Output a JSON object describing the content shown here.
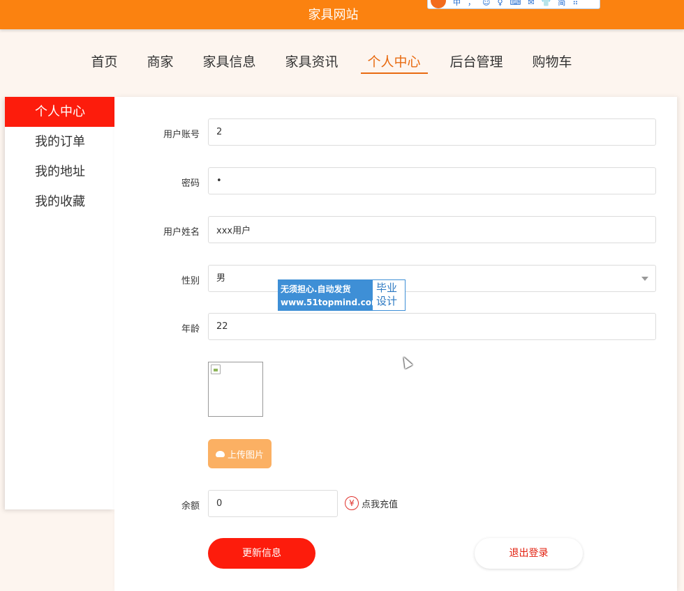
{
  "site": {
    "title": "家具网站"
  },
  "ime": {
    "items": [
      "中",
      "，",
      "☺",
      "♀",
      "⌨",
      "✉",
      "👕",
      "简",
      "⠿"
    ]
  },
  "nav": {
    "items": [
      {
        "label": "首页"
      },
      {
        "label": "商家"
      },
      {
        "label": "家具信息"
      },
      {
        "label": "家具资讯"
      },
      {
        "label": "个人中心",
        "active": true
      },
      {
        "label": "后台管理"
      },
      {
        "label": "购物车"
      }
    ]
  },
  "sidebar": {
    "items": [
      {
        "label": "个人中心",
        "active": true
      },
      {
        "label": "我的订单"
      },
      {
        "label": "我的地址"
      },
      {
        "label": "我的收藏"
      }
    ]
  },
  "form": {
    "account": {
      "label": "用户账号",
      "value": "2"
    },
    "password": {
      "label": "密码",
      "value": "•"
    },
    "name": {
      "label": "用户姓名",
      "value": "xxx用户"
    },
    "gender": {
      "label": "性别",
      "value": "男"
    },
    "age": {
      "label": "年龄",
      "value": "22"
    },
    "upload_label": "上传图片",
    "balance": {
      "label": "余额",
      "value": "0"
    },
    "recharge_label": "点我充值",
    "update_label": "更新信息",
    "logout_label": "退出登录"
  },
  "watermark": {
    "line1": "无须担心.自动发货",
    "line2": "www.51topmind.com",
    "right1": "毕业",
    "right2": "设计"
  },
  "colors": {
    "header": "#fb8210",
    "accent": "#e86a10",
    "primary_red": "#fd1c0c",
    "upload": "#fbb063"
  }
}
